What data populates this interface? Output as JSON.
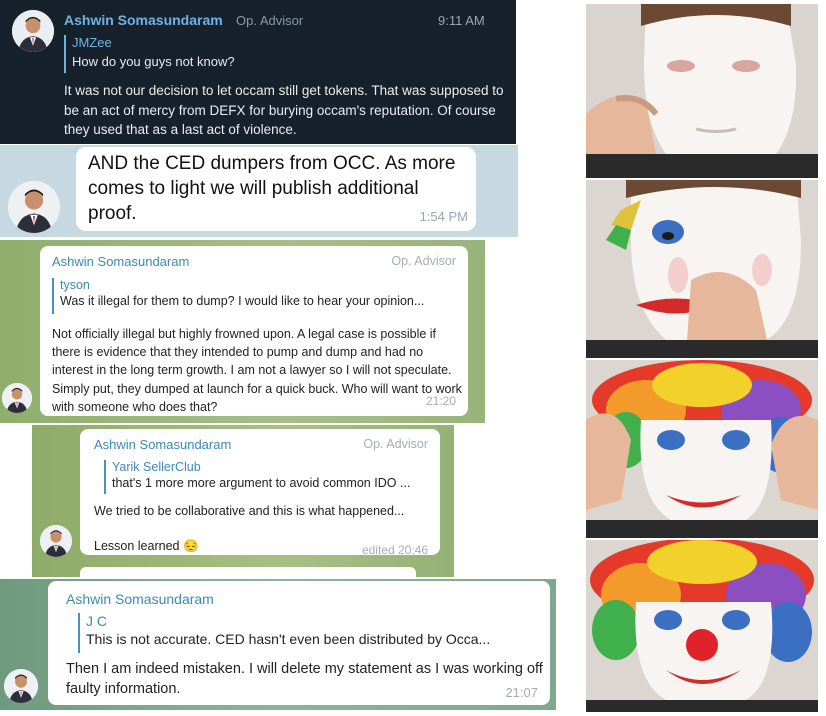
{
  "messages": [
    {
      "author": "Ashwin Somasundaram",
      "role": "Op. Advisor",
      "time": "9:11 AM",
      "reply_author": "JMZee",
      "reply_text": "How do you guys not know?",
      "text": "It was not our decision to let occam still get tokens. That was supposed to be an act of mercy from DEFX for burying occam's reputation. Of course they used that as a last act of violence."
    },
    {
      "text": "AND the CED dumpers from OCC. As more comes to light we will publish additional proof.",
      "time": "1:54 PM"
    },
    {
      "author": "Ashwin Somasundaram",
      "role": "Op. Advisor",
      "reply_author": "tyson",
      "reply_text": "Was it illegal for them to dump? I would like to hear your opinion...",
      "text": "Not officially illegal but highly frowned upon. A legal case is possible if there is evidence that they intended to pump and dump and had no interest in the long term growth. I am not a lawyer so I will not speculate. Simply put, they dumped at launch for a quick buck. Who will want to work with someone who does that?",
      "time": "21:20"
    },
    {
      "author": "Ashwin Somasundaram",
      "role": "Op. Advisor",
      "reply_author": "Yarik SellerClub",
      "reply_text": "that's 1 more more argument to avoid common IDO ...",
      "text": "We tried to be collaborative and this is what happened...",
      "text2": "Lesson learned 😔",
      "time": "edited 20:46"
    },
    {
      "author": "Ashwin Somasundaram",
      "reply_author": "J C",
      "reply_text": "This is not accurate. CED hasn't even been distributed by Occa...",
      "text": "Then I am indeed mistaken. I will delete my statement as I was working off faulty information.",
      "time": "21:07"
    }
  ],
  "icons": {
    "avatar": "avatar-icon"
  },
  "colors": {
    "dark_bg": "#17212b",
    "name_blue": "#3d8ab5",
    "green_bg": "#a7bf86"
  }
}
